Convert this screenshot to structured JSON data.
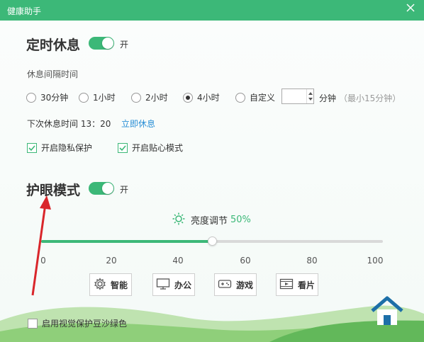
{
  "window": {
    "title": "健康助手"
  },
  "rest": {
    "title": "定时休息",
    "toggle_label": "开",
    "interval_label": "休息间隔时间",
    "options": [
      "30分钟",
      "1小时",
      "2小时",
      "4小时",
      "自定义"
    ],
    "selected": "4小时",
    "custom_value": "",
    "custom_unit": "分钟",
    "custom_hint": "（最小15分钟）",
    "next_rest": "下次休息时间 13：20",
    "rest_now": "立即休息",
    "privacy": "开启隐私保护",
    "caring": "开启贴心模式"
  },
  "eye": {
    "title": "护眼模式",
    "toggle_label": "开",
    "brightness_label": "亮度调节",
    "brightness_value": "50%",
    "brightness_fraction": 0.5,
    "ticks": [
      "0",
      "20",
      "40",
      "60",
      "80",
      "100"
    ],
    "modes": [
      {
        "label": "智能",
        "icon": "gear-icon"
      },
      {
        "label": "办公",
        "icon": "monitor-icon"
      },
      {
        "label": "游戏",
        "icon": "gamepad-icon"
      },
      {
        "label": "看片",
        "icon": "film-icon"
      }
    ],
    "green_bg": "启用视觉保护豆沙绿色"
  },
  "colors": {
    "accent": "#3cb878",
    "titlebar": "#3cb878",
    "link": "#2a8fd6",
    "arrow": "#d9262b"
  }
}
